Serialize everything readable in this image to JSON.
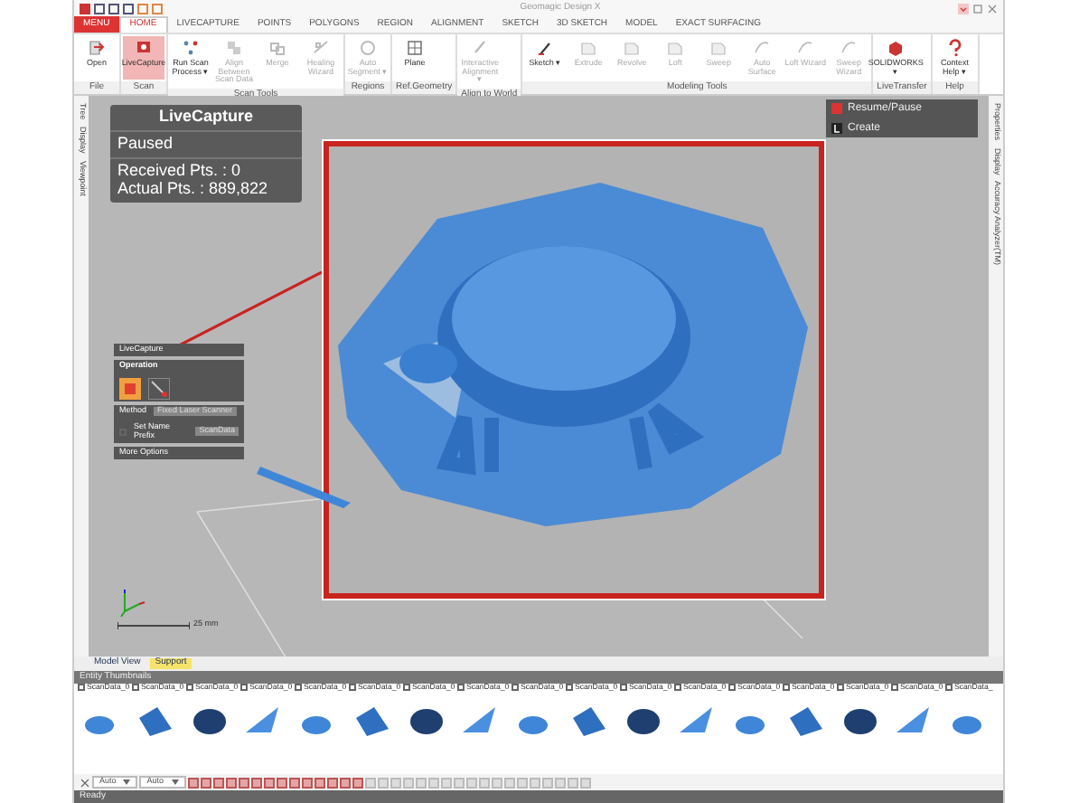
{
  "window": {
    "title": "Geomagic Design X"
  },
  "menu_label": "MENU",
  "tabs": [
    {
      "label": "HOME",
      "selected": true
    },
    {
      "label": "LIVECAPTURE",
      "selected": false
    },
    {
      "label": "POINTS",
      "selected": false
    },
    {
      "label": "POLYGONS",
      "selected": false
    },
    {
      "label": "REGION",
      "selected": false
    },
    {
      "label": "ALIGNMENT",
      "selected": false
    },
    {
      "label": "SKETCH",
      "selected": false
    },
    {
      "label": "3D SKETCH",
      "selected": false
    },
    {
      "label": "MODEL",
      "selected": false
    },
    {
      "label": "EXACT SURFACING",
      "selected": false
    }
  ],
  "ribbon_groups": [
    {
      "label": "File",
      "buttons": [
        {
          "label": "Open",
          "kind": "open",
          "selected": false,
          "disabled": false
        }
      ]
    },
    {
      "label": "Scan",
      "buttons": [
        {
          "label": "LiveCapture",
          "kind": "capture",
          "selected": true,
          "disabled": false
        }
      ]
    },
    {
      "label": "Scan Tools",
      "buttons": [
        {
          "label": "Run Scan Process ▾",
          "kind": "process",
          "selected": false,
          "disabled": false
        },
        {
          "label": "Align Between Scan Data",
          "kind": "align",
          "selected": false,
          "disabled": true
        },
        {
          "label": "Merge",
          "kind": "merge",
          "selected": false,
          "disabled": true
        },
        {
          "label": "Healing Wizard",
          "kind": "heal",
          "selected": false,
          "disabled": true
        }
      ]
    },
    {
      "label": "Regions",
      "buttons": [
        {
          "label": "Auto Segment ▾",
          "kind": "segment",
          "selected": false,
          "disabled": true
        }
      ]
    },
    {
      "label": "Ref.Geometry",
      "buttons": [
        {
          "label": "Plane",
          "kind": "plane",
          "selected": false,
          "disabled": false
        }
      ]
    },
    {
      "label": "Align to World",
      "buttons": [
        {
          "label": "Interactive Alignment ▾",
          "kind": "world",
          "selected": false,
          "disabled": true
        }
      ]
    },
    {
      "label": "Modeling Tools",
      "buttons": [
        {
          "label": "Sketch ▾",
          "kind": "sketch",
          "selected": false,
          "disabled": false
        },
        {
          "label": "Extrude",
          "kind": "solid",
          "selected": false,
          "disabled": true
        },
        {
          "label": "Revolve",
          "kind": "solid",
          "selected": false,
          "disabled": true
        },
        {
          "label": "Loft",
          "kind": "solid",
          "selected": false,
          "disabled": true
        },
        {
          "label": "Sweep",
          "kind": "solid",
          "selected": false,
          "disabled": true
        },
        {
          "label": "Auto Surface",
          "kind": "surface",
          "selected": false,
          "disabled": true
        },
        {
          "label": "Loft Wizard",
          "kind": "surface",
          "selected": false,
          "disabled": true
        },
        {
          "label": "Sweep Wizard",
          "kind": "surface",
          "selected": false,
          "disabled": true
        }
      ]
    },
    {
      "label": "LiveTransfer",
      "buttons": [
        {
          "label": "SOLIDWORKS ▾",
          "kind": "transfer",
          "selected": false,
          "disabled": false
        }
      ]
    },
    {
      "label": "Help",
      "buttons": [
        {
          "label": "Context Help ▾",
          "kind": "help",
          "selected": false,
          "disabled": false
        }
      ]
    }
  ],
  "left_side_tabs": [
    "Tree",
    "Display",
    "Viewpoint"
  ],
  "right_side_tabs": [
    "Properties",
    "Display",
    "Accuracy Analyzer(TM)"
  ],
  "capture_panel": {
    "title": "LiveCapture",
    "status": "Paused",
    "received": "Received Pts. : 0",
    "actual": "Actual Pts. : 889,822"
  },
  "capture_menu": [
    {
      "label": "Resume/Pause",
      "kind": "pause"
    },
    {
      "label": "Create",
      "kind": "create"
    }
  ],
  "property_panel": {
    "title": "LiveCapture",
    "section": "Operation",
    "method_label": "Method",
    "method_value": "Fixed Laser Scanner",
    "name_prefix_label": "Set Name Prefix",
    "name_prefix_value": "ScanData",
    "name_prefix_checked": false,
    "more": "More Options"
  },
  "scale_label": "25 mm",
  "view_tabs": [
    {
      "label": "Model View",
      "selected": false
    },
    {
      "label": "Support",
      "selected": true
    }
  ],
  "thumbnails": {
    "title": "Entity Thumbnails",
    "items": [
      {
        "label": "ScanData_0",
        "checked": false
      },
      {
        "label": "ScanData_0",
        "checked": false
      },
      {
        "label": "ScanData_0",
        "checked": false
      },
      {
        "label": "ScanData_0",
        "checked": false
      },
      {
        "label": "ScanData_0",
        "checked": false
      },
      {
        "label": "ScanData_0",
        "checked": false
      },
      {
        "label": "ScanData_0",
        "checked": false
      },
      {
        "label": "ScanData_0",
        "checked": false
      },
      {
        "label": "ScanData_0",
        "checked": false
      },
      {
        "label": "ScanData_0",
        "checked": false
      },
      {
        "label": "ScanData_0",
        "checked": false
      },
      {
        "label": "ScanData_0",
        "checked": false
      },
      {
        "label": "ScanData_0",
        "checked": false
      },
      {
        "label": "ScanData_0",
        "checked": false
      },
      {
        "label": "ScanData_0",
        "checked": false
      },
      {
        "label": "ScanData_0",
        "checked": false
      },
      {
        "label": "ScanData_",
        "checked": false
      }
    ]
  },
  "toolbar": {
    "selects": [
      "Auto",
      "Auto"
    ]
  },
  "status_bar": "Ready"
}
